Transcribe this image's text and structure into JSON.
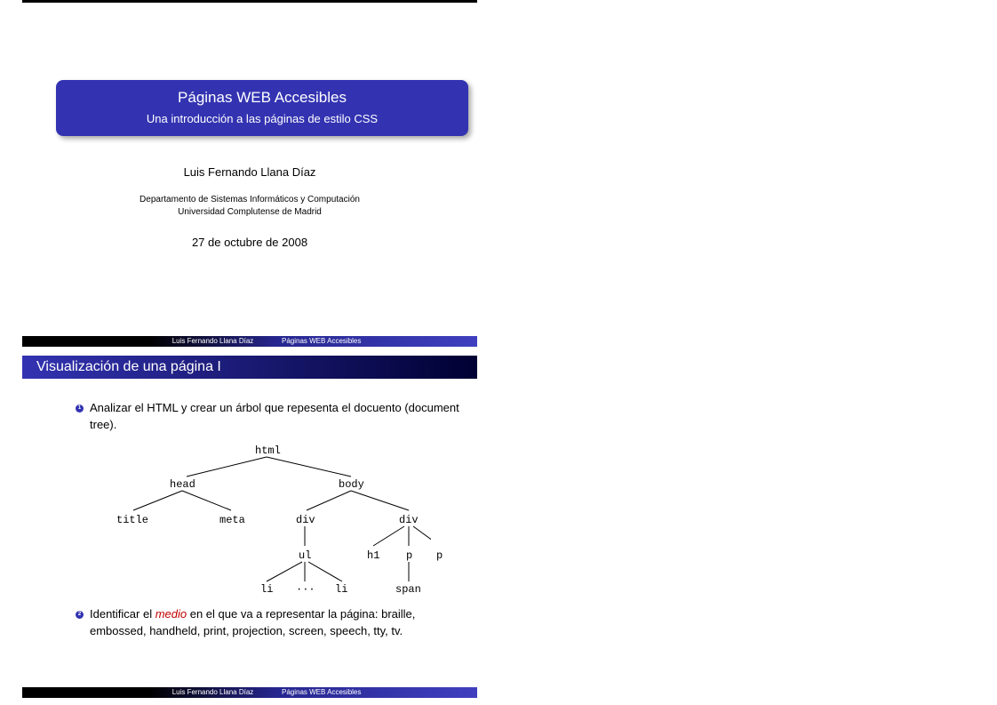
{
  "slide1": {
    "title": "Páginas WEB Accesibles",
    "subtitle": "Una introducción a las páginas de estilo CSS",
    "author": "Luis Fernando Llana Díaz",
    "dept_line1": "Departamento de Sistemas Informáticos y Computación",
    "dept_line2": "Universidad Complutense de Madrid",
    "date": "27 de octubre de 2008"
  },
  "slide2": {
    "header": "Visualización de una página I",
    "item1_num": "1",
    "item1_text": "Analizar el HTML y crear un árbol que repesenta el docuento (document tree).",
    "item2_num": "2",
    "item2_prefix": "Identificar el ",
    "item2_medio": "medio",
    "item2_suffix": " en el que va a representar la página: braille, embossed, handheld, print, projection, screen, speech, tty, tv."
  },
  "tree": {
    "html": "html",
    "head": "head",
    "body": "body",
    "title": "title",
    "meta": "meta",
    "div1": "div",
    "div2": "div",
    "ul": "ul",
    "li1": "li",
    "dots": "···",
    "li2": "li",
    "h1": "h1",
    "p1": "p",
    "p2": "p",
    "span": "span"
  },
  "footer": {
    "author": "Luis Fernando Llana Díaz",
    "title": "Páginas WEB Accesibles"
  }
}
